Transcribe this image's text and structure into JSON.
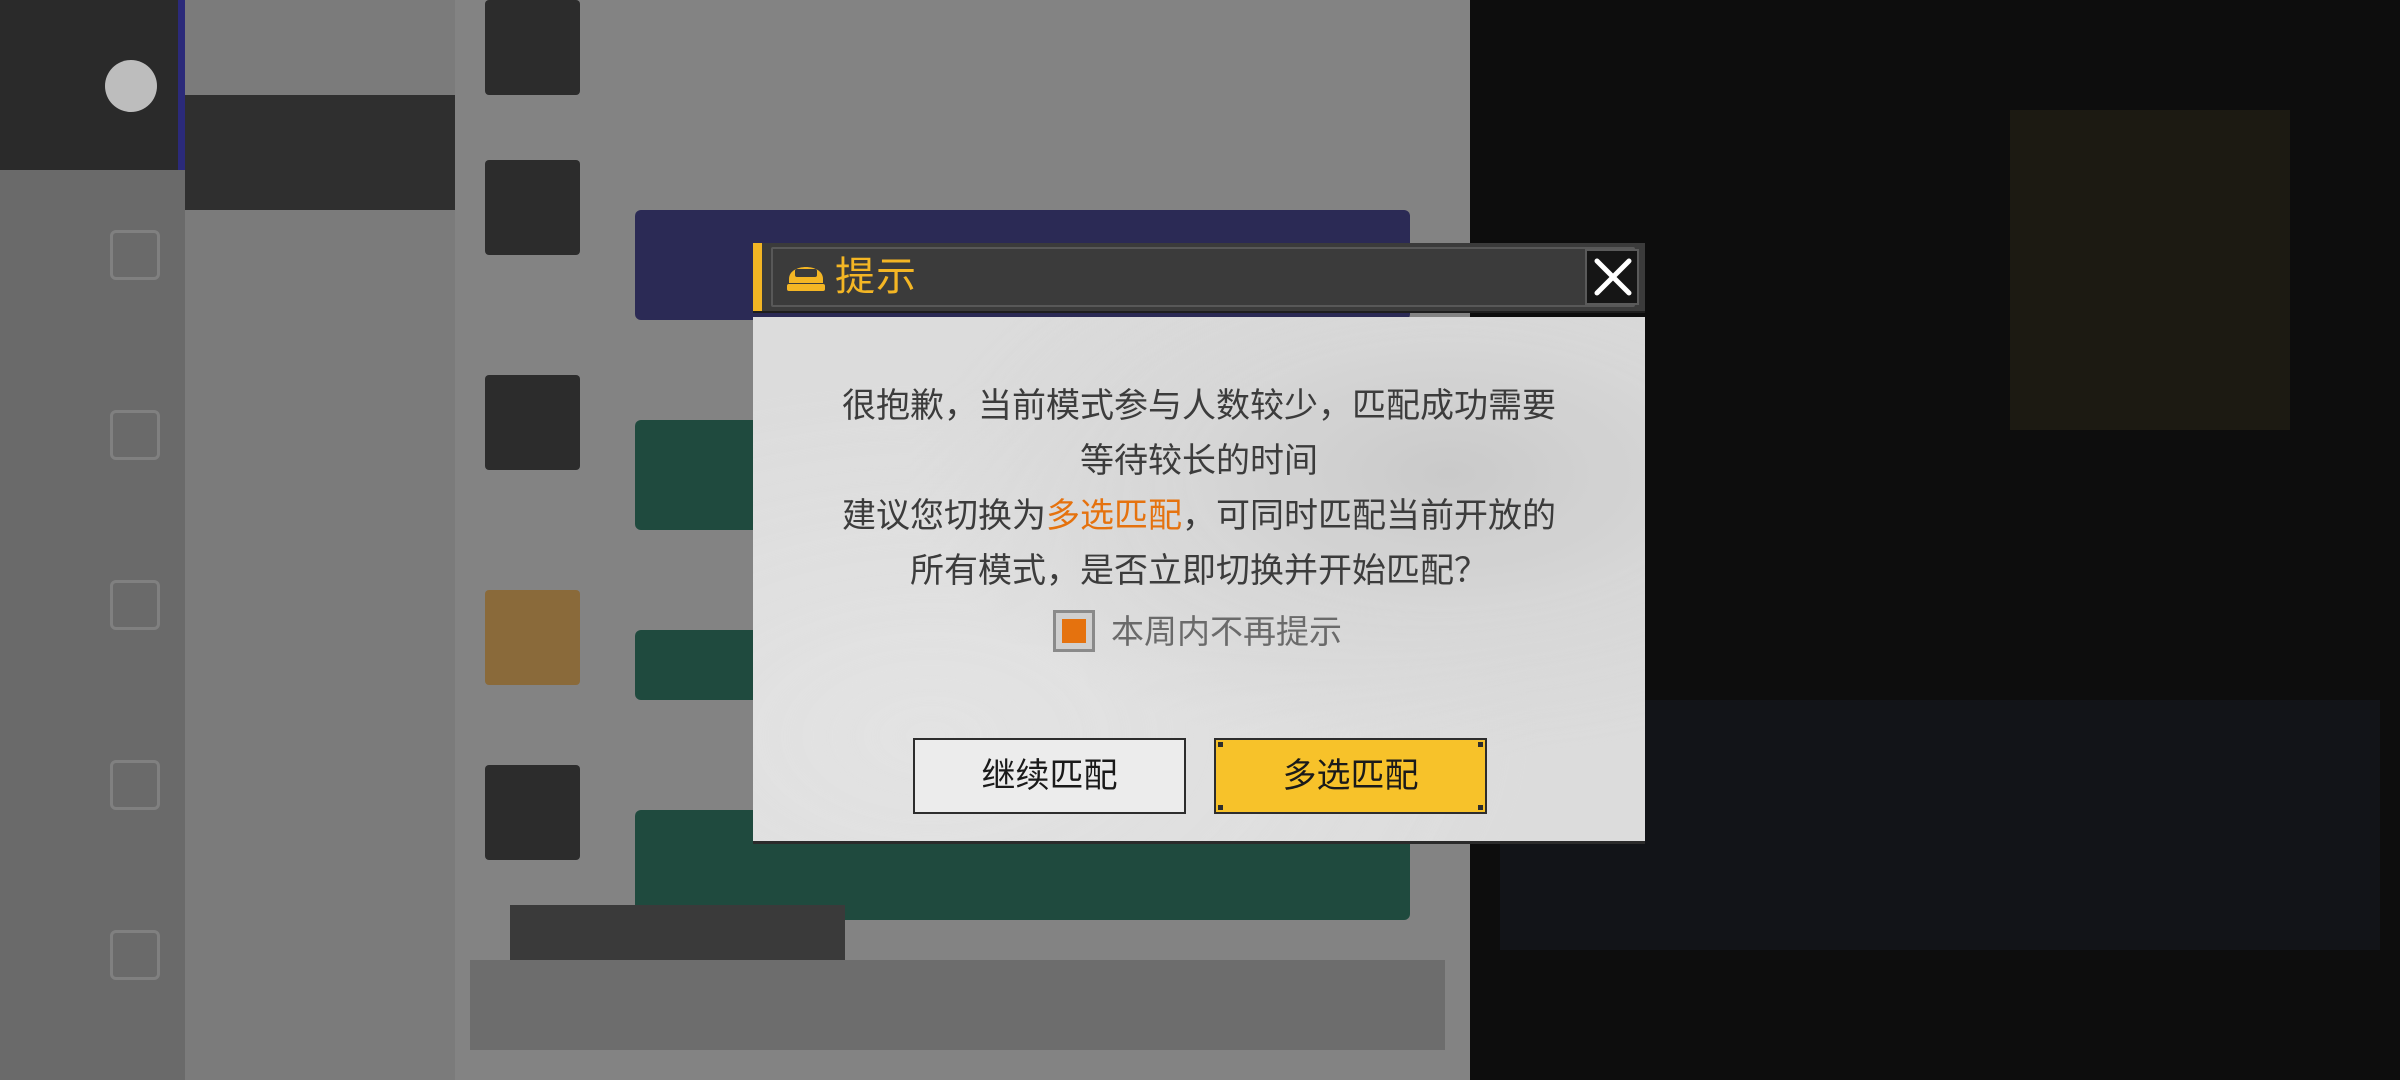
{
  "background": {
    "friend_list": [
      "",
      "",
      "",
      "",
      "",
      "",
      "",
      ""
    ],
    "dim": true
  },
  "dialog": {
    "title": "提示",
    "icon": "helmet-icon",
    "close_icon": "close-icon",
    "message_line1": "很抱歉，当前模式参与人数较少，匹配成功需要",
    "message_line2": "等待较长的时间",
    "message_line3_pre": "建议您切换为",
    "message_line3_highlight": "多选匹配",
    "message_line3_post": "，可同时匹配当前开放的",
    "message_line4": "所有模式，是否立即切换并开始匹配？",
    "checkbox_label": "本周内不再提示",
    "checkbox_checked": true,
    "btn_continue": "继续匹配",
    "btn_multi": "多选匹配"
  },
  "colors": {
    "accent_yellow": "#f4b624",
    "highlight_orange": "#e5720e",
    "primary_button": "#f7c22a"
  }
}
